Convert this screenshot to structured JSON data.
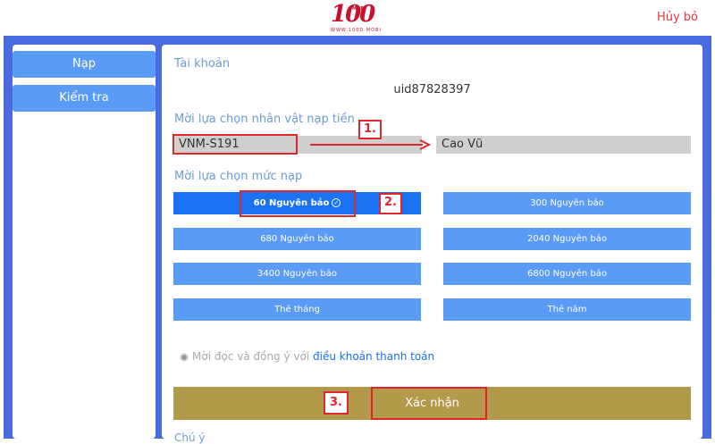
{
  "header": {
    "logo_text": "100",
    "logo_tag": "MOBI",
    "logo_url": "WWW.100D.MOBI",
    "cancel_label": "Hủy bỏ"
  },
  "sidebar": {
    "items": [
      {
        "label": "Nạp"
      },
      {
        "label": "Kiểm tra"
      }
    ]
  },
  "account": {
    "label": "Tài khoản",
    "uid": "uid87828397"
  },
  "character": {
    "label": "Mời lựa chọn nhân vật nạp tiền",
    "server": "VNM-S191",
    "name": "Cao Vũ"
  },
  "amount": {
    "label": "Mời lựa chọn mức nạp",
    "options": [
      {
        "label": "60 Nguyên bảo",
        "selected": true
      },
      {
        "label": "300 Nguyên bảo"
      },
      {
        "label": "680 Nguyên bảo"
      },
      {
        "label": "2040 Nguyên bảo"
      },
      {
        "label": "3400 Nguyên bảo"
      },
      {
        "label": "6800 Nguyên bảo"
      },
      {
        "label": "Thẻ tháng"
      },
      {
        "label": "Thẻ năm"
      }
    ]
  },
  "agreement": {
    "text": "Mời đọc và đồng ý với",
    "link": "điều khoản thanh toán"
  },
  "confirm_label": "Xác nhận",
  "note_label": "Chú ý",
  "annotations": {
    "step1": "1.",
    "step2": "2.",
    "step3": "3."
  },
  "colors": {
    "frame": "#4a6bdf",
    "option": "#5b9bf8",
    "option_selected": "#1a72f3",
    "confirm": "#b39a4a",
    "highlight": "#e0262d"
  }
}
